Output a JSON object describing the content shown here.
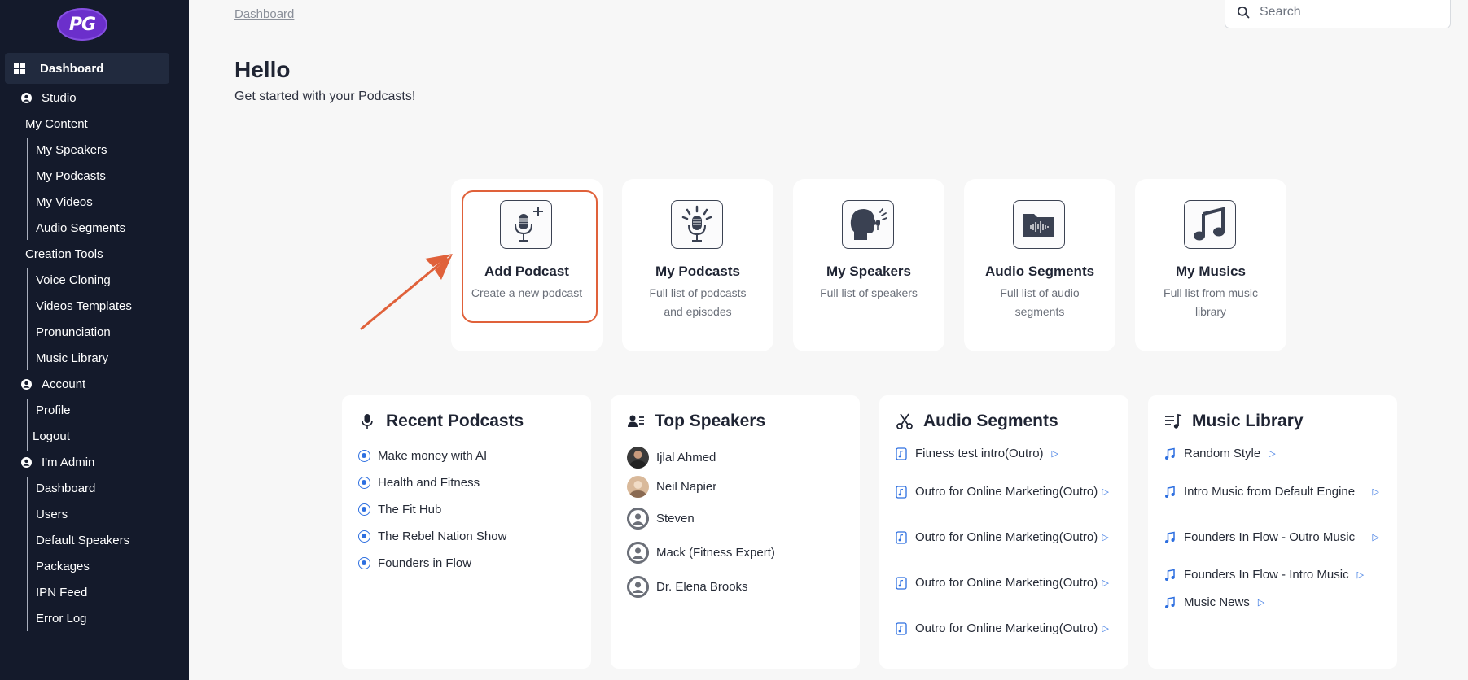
{
  "brand": {
    "logo_text": "PG"
  },
  "sidebar": {
    "dashboard": "Dashboard",
    "studio": "Studio",
    "my_content": "My Content",
    "my_content_items": [
      "My Speakers",
      "My Podcasts",
      "My Videos",
      "Audio Segments"
    ],
    "creation_tools": "Creation Tools",
    "creation_tools_items": [
      "Voice Cloning",
      "Videos Templates",
      "Pronunciation",
      "Music Library"
    ],
    "account": "Account",
    "account_items": [
      "Profile",
      "Logout"
    ],
    "admin": "I'm Admin",
    "admin_items": [
      "Dashboard",
      "Users",
      "Default Speakers",
      "Packages",
      "IPN Feed",
      "Error Log"
    ]
  },
  "header": {
    "breadcrumb": "Dashboard",
    "search_placeholder": "Search"
  },
  "main": {
    "greeting": "Hello",
    "subgreeting": "Get started with your Podcasts!"
  },
  "quick_actions": [
    {
      "title": "Add Podcast",
      "desc": "Create a new podcast",
      "icon": "mic-plus-icon"
    },
    {
      "title": "My Podcasts",
      "desc": "Full list of podcasts and episodes",
      "icon": "mic-broadcast-icon"
    },
    {
      "title": "My Speakers",
      "desc": "Full list of speakers",
      "icon": "speaker-head-icon"
    },
    {
      "title": "Audio Segments",
      "desc": "Full list of audio segments",
      "icon": "audio-folder-icon"
    },
    {
      "title": "My Musics",
      "desc": "Full list from music library",
      "icon": "music-note-icon"
    }
  ],
  "panels": {
    "recent_podcasts": {
      "title": "Recent Podcasts",
      "items": [
        "Make money with AI",
        "Health and Fitness",
        "The Fit Hub",
        "The Rebel Nation Show",
        "Founders in Flow"
      ]
    },
    "top_speakers": {
      "title": "Top Speakers",
      "items": [
        "Ijlal Ahmed",
        "Neil Napier",
        "Steven",
        "Mack (Fitness Expert)",
        "Dr. Elena Brooks"
      ]
    },
    "audio_segments": {
      "title": "Audio Segments",
      "items": [
        "Fitness test intro(Outro)",
        "Outro for Online Marketing(Outro)",
        "Outro for Online Marketing(Outro)",
        "Outro for Online Marketing(Outro)",
        "Outro for Online Marketing(Outro)"
      ]
    },
    "music_library": {
      "title": "Music Library",
      "items": [
        "Random Style",
        "Intro Music from Default Engine",
        "Founders In Flow - Outro Music",
        "Founders In Flow - Intro Music",
        "Music News"
      ]
    }
  },
  "colors": {
    "sidebar_bg": "#141a2b",
    "accent_blue": "#2d6fe0",
    "highlight_orange": "#e0613a",
    "logo_purple": "#6b2fcb"
  }
}
